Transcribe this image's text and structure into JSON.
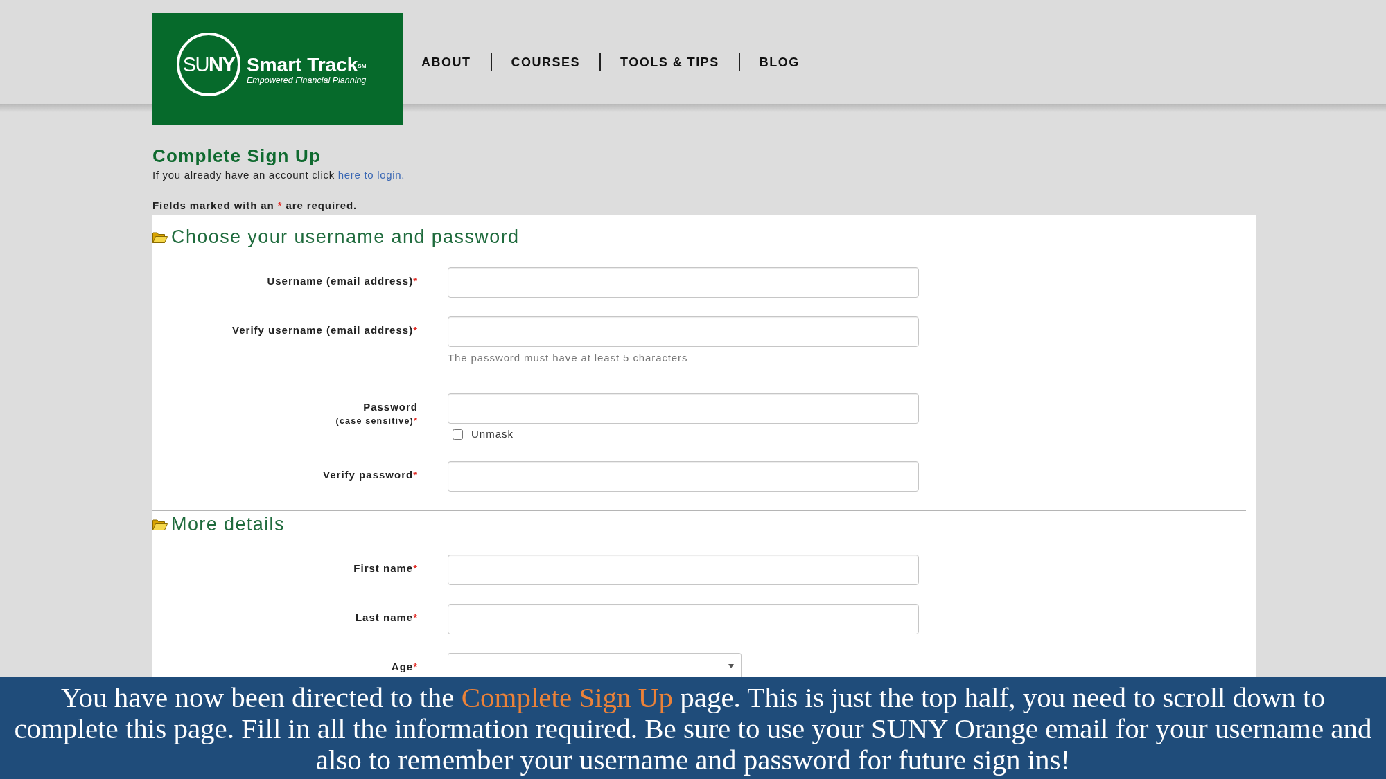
{
  "header": {
    "logo": {
      "emblem": "SU**NY**",
      "name": "Smart Track$^{SM}$",
      "tagline": "Empowered Financial Planning"
    },
    "nav": [
      "ABOUT",
      "COURSES",
      "TOOLS & TIPS",
      "BLOG"
    ]
  },
  "title": "Complete Sign Up",
  "login_prompt": {
    "text": "If you already have an account click",
    "link": "here to login."
  },
  "required_note": {
    "before": "Fields marked with an",
    "mark": "*",
    "after": "are required."
  },
  "sections": [
    {
      "title": "Choose your username and password",
      "fields": [
        {
          "kind": "text",
          "label": "Username (email address)",
          "mark": "*"
        },
        {
          "kind": "text",
          "label": "Verify username (email address)",
          "mark": "*",
          "hint": "The password must have at least 5 characters"
        },
        {
          "kind": "password",
          "label": "Password",
          "sublabel": "(case sensitive)",
          "mark": "*",
          "checkbox": {
            "label": "Unmask",
            "checked": false
          }
        },
        {
          "kind": "password",
          "label": "Verify password",
          "mark": "*"
        }
      ]
    },
    {
      "title": "More details",
      "fields": [
        {
          "kind": "text",
          "label": "First name",
          "mark": "*"
        },
        {
          "kind": "text",
          "label": "Last name",
          "mark": "*"
        },
        {
          "kind": "select",
          "label": "Age",
          "mark": "*"
        }
      ]
    }
  ],
  "caption": {
    "parts": [
      {
        "text": "You have now been directed to the ",
        "highlight": false
      },
      {
        "text": "Complete Sign Up",
        "highlight": true
      },
      {
        "text": " page. This is just the top half, you need to scroll down to complete this page. Fill in all the information required. Be sure to use your SUNY Orange email for your username and also to remember your username and password for future sign ins!",
        "highlight": false
      }
    ]
  }
}
